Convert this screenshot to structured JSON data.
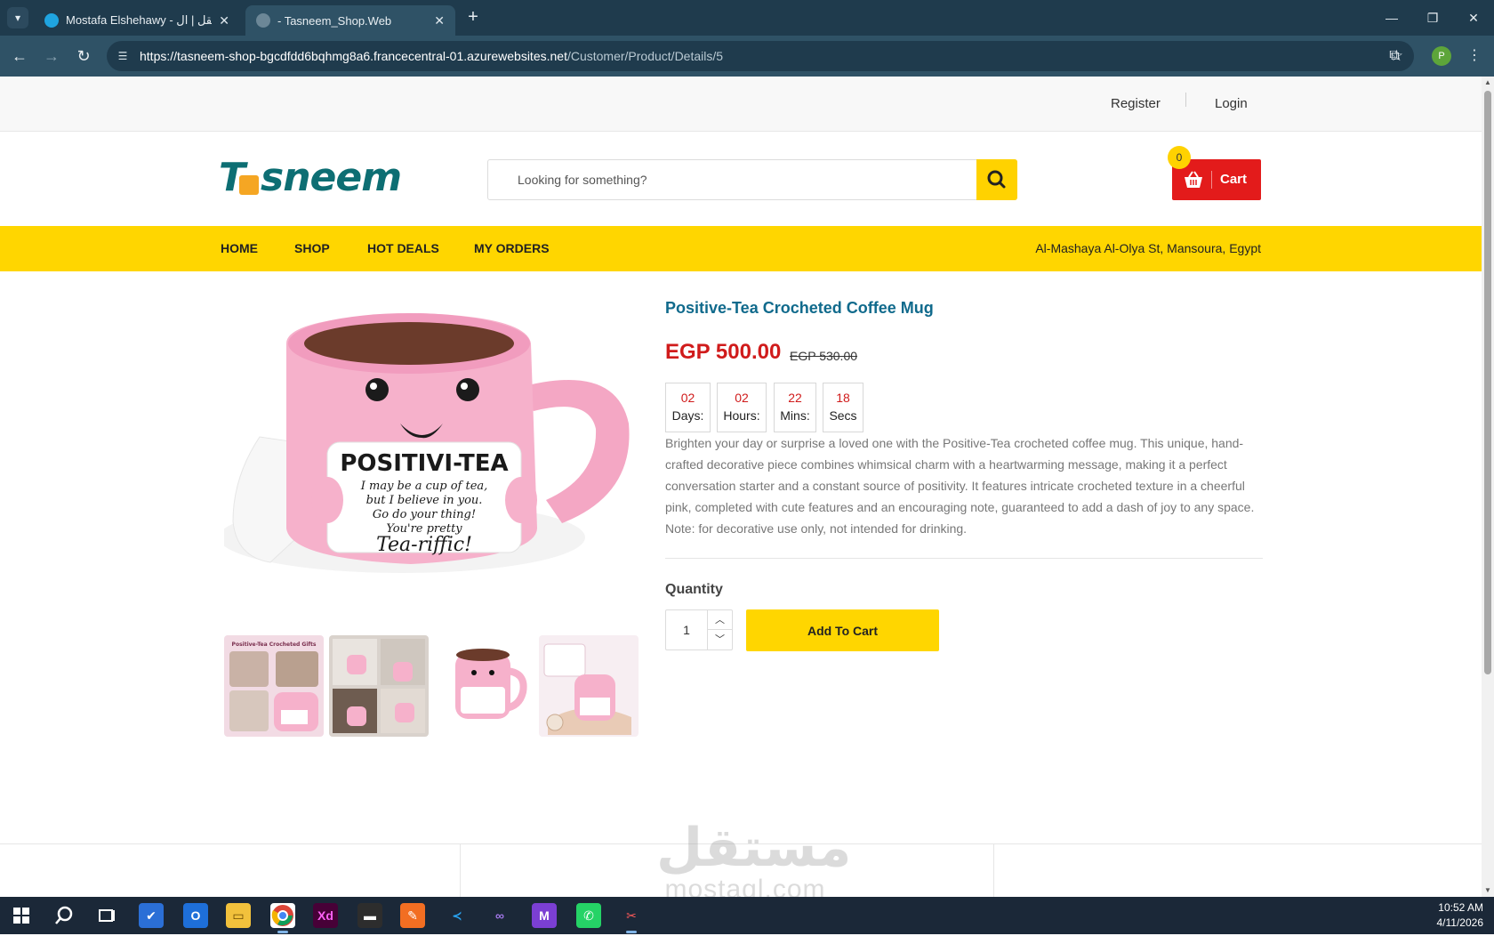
{
  "browser": {
    "tabs": [
      {
        "title": "Mostafa Elshehawy - مستقل | ال",
        "active": false
      },
      {
        "title": "- Tasneem_Shop.Web",
        "active": true
      }
    ],
    "url_host": "https://tasneem-shop-bgcdfdd6bqhmg8a6.francecentral-01.azurewebsites.net",
    "url_path": "/Customer/Product/Details/5",
    "profile_initial": "P"
  },
  "topbar": {
    "register": "Register",
    "login": "Login"
  },
  "header": {
    "logo_text_t": "T",
    "logo_text_rest": "sneem",
    "search_placeholder": "Looking for something?",
    "cart_label": "Cart",
    "cart_count": "0"
  },
  "nav": {
    "items": [
      "HOME",
      "SHOP",
      "HOT DEALS",
      "MY ORDERS"
    ],
    "address": "Al-Mashaya Al-Olya St, Mansoura, Egypt"
  },
  "product": {
    "title": "Positive-Tea Crocheted Coffee Mug",
    "price": "EGP 500.00",
    "old_price": "EGP 530.00",
    "countdown": [
      {
        "value": "02",
        "unit": "Days:"
      },
      {
        "value": "02",
        "unit": "Hours:"
      },
      {
        "value": "22",
        "unit": "Mins:"
      },
      {
        "value": "18",
        "unit": "Secs"
      }
    ],
    "description": "Brighten your day or surprise a loved one with the Positive-Tea crocheted coffee mug. This unique, hand-crafted decorative piece combines whimsical charm with a heartwarming message, making it a perfect conversation starter and a constant source of positivity. It features intricate crocheted texture in a cheerful pink, completed with cute features and an encouraging note, guaranteed to add a dash of joy to any space. Note: for decorative use only, not intended for drinking.",
    "quantity_label": "Quantity",
    "quantity_value": "1",
    "add_to_cart": "Add To Cart",
    "image_card": {
      "heading": "POSITIVI-TEA",
      "line1": "I may be a cup of tea,",
      "line2": "but I believe in you.",
      "line3": "Go do your thing!",
      "line4": "You're pretty",
      "line5": "Tea-riffic!"
    },
    "thumb_caption": "Positive-Tea Crocheted Gifts"
  },
  "watermark": {
    "arabic": "مستقل",
    "latin": "mostaql.com"
  },
  "taskbar": {
    "time": "10:52 AM",
    "date": "4/11/2026"
  },
  "colors": {
    "brand_yellow": "#ffd600",
    "price_red": "#d01b1b",
    "title_blue": "#106a8c",
    "cart_red": "#e31b1b",
    "logo_teal": "#0d6e73"
  }
}
